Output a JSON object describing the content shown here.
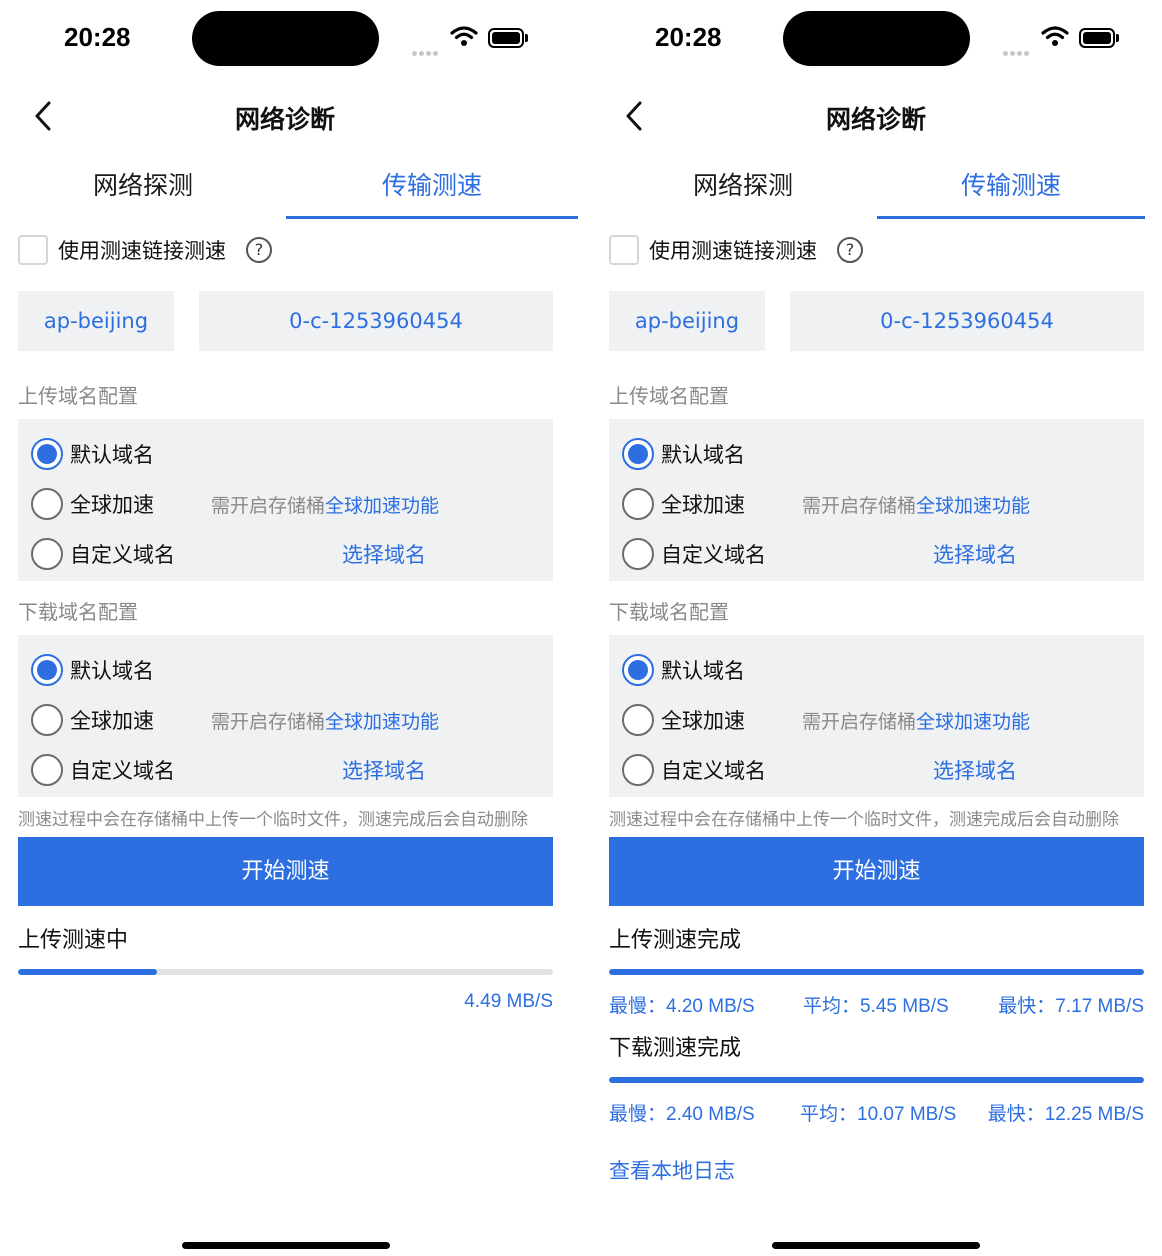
{
  "screens": [
    {
      "status_bar": {
        "time": "20:28"
      },
      "nav": {
        "title": "网络诊断"
      },
      "tabs": [
        {
          "label": "网络探测"
        },
        {
          "label": "传输测速"
        }
      ],
      "use_speed_link": {
        "label": "使用测速链接测速",
        "checked": false
      },
      "region": "ap-beijing",
      "bucket": "0-c-1253960454",
      "upload_config": {
        "title": "上传域名配置",
        "options": [
          {
            "label": "默认域名",
            "selected": true
          },
          {
            "label": "全球加速",
            "note_prefix": "需开启存储桶",
            "note_link": "全球加速功能"
          },
          {
            "label": "自定义域名",
            "action": "选择域名"
          }
        ]
      },
      "download_config": {
        "title": "下载域名配置",
        "options": [
          {
            "label": "默认域名",
            "selected": true
          },
          {
            "label": "全球加速",
            "note_prefix": "需开启存储桶",
            "note_link": "全球加速功能"
          },
          {
            "label": "自定义域名",
            "action": "选择域名"
          }
        ]
      },
      "hint": "测速过程中会在存储桶中上传一个临时文件，测速完成后会自动删除",
      "start_button": "开始测速",
      "upload_status": {
        "title": "上传测速中",
        "progress": 0.26,
        "current_speed": "4.49 MB/S"
      }
    },
    {
      "status_bar": {
        "time": "20:28"
      },
      "nav": {
        "title": "网络诊断"
      },
      "tabs": [
        {
          "label": "网络探测"
        },
        {
          "label": "传输测速"
        }
      ],
      "use_speed_link": {
        "label": "使用测速链接测速",
        "checked": false
      },
      "region": "ap-beijing",
      "bucket": "0-c-1253960454",
      "upload_config": {
        "title": "上传域名配置",
        "options": [
          {
            "label": "默认域名",
            "selected": true
          },
          {
            "label": "全球加速",
            "note_prefix": "需开启存储桶",
            "note_link": "全球加速功能"
          },
          {
            "label": "自定义域名",
            "action": "选择域名"
          }
        ]
      },
      "download_config": {
        "title": "下载域名配置",
        "options": [
          {
            "label": "默认域名",
            "selected": true
          },
          {
            "label": "全球加速",
            "note_prefix": "需开启存储桶",
            "note_link": "全球加速功能"
          },
          {
            "label": "自定义域名",
            "action": "选择域名"
          }
        ]
      },
      "hint": "测速过程中会在存储桶中上传一个临时文件，测速完成后会自动删除",
      "start_button": "开始测速",
      "upload_result": {
        "title": "上传测速完成",
        "progress": 1.0,
        "slowest": "最慢：4.20 MB/S",
        "average": "平均：5.45 MB/S",
        "fastest": "最快：7.17 MB/S"
      },
      "download_result": {
        "title": "下载测速完成",
        "progress": 1.0,
        "slowest": "最慢：2.40 MB/S",
        "average": "平均：10.07 MB/S",
        "fastest": "最快：12.25 MB/S"
      },
      "log_link": "查看本地日志"
    }
  ],
  "colors": {
    "accent": "#2d6fe0",
    "panel": "#f0f1f3",
    "muted": "#8a8a8a"
  }
}
